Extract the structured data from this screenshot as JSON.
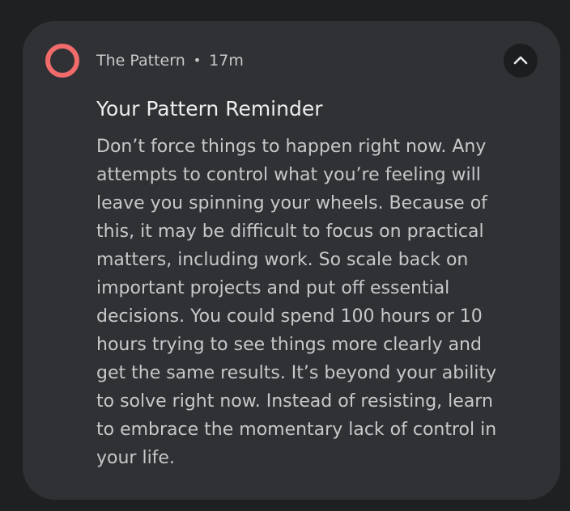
{
  "notification": {
    "app_name": "The Pattern",
    "separator": "•",
    "time": "17m",
    "app_icon": "ring-icon",
    "expand_icon": "chevron-up-icon",
    "title": "Your Pattern Reminder",
    "body_lines": [
      "Don’t force things to happen right now. Any",
      "attempts to control what you’re feeling will",
      "leave you spinning your wheels. Because of",
      "this, it may be difficult to focus on practical",
      "matters, including work. So scale back on",
      "important projects and put off essential",
      "decisions. You could spend 100 hours or 10",
      "hours trying to see things more clearly and",
      "get the same results. It’s beyond your ability",
      "to solve right now. Instead of resisting, learn",
      "to embrace the momentary lack of control in",
      "your life."
    ]
  },
  "colors": {
    "background": "#1f2022",
    "card": "#2f3134",
    "accent": "#f26b6b",
    "title": "#eceded",
    "text": "#c7c8ca",
    "button": "#1c1d1f"
  }
}
